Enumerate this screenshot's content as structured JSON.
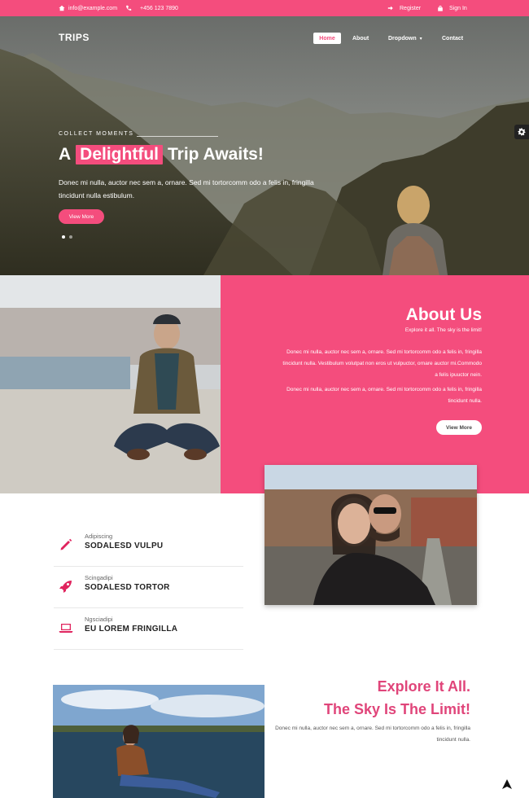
{
  "topbar": {
    "email": "info@example.com",
    "phone": "+456 123 7890",
    "register": "Register",
    "signin": "Sign In"
  },
  "header": {
    "brand": "TRIPS",
    "nav": [
      "Home",
      "About",
      "Dropdown",
      "Contact"
    ]
  },
  "hero": {
    "eyebrow": "COLLECT MOMENTS",
    "headline_pre": "A",
    "headline_highlight": "Delightful",
    "headline_post": "Trip Awaits!",
    "text": "Donec mi nulla, auctor nec sem a, ornare. Sed mi tortorcomm odo a felis in, fringilla tincidunt nulla estibulum.",
    "button": "View More",
    "slides": 2
  },
  "about": {
    "title": "About Us",
    "subtitle": "Explore it all. The sky is the limit!",
    "p1": "Donec mi nulla, auctor nec sem a, ornare. Sed mi tortorcomm odo a felis in, fringilla tincidunt nulla. Vestibulum volutpat non eros ut vulpuctor, ornare auctor mi.Commodo a felis ipuuctor nein.",
    "p2": "Donec mi nulla, auctor nec sem a, ornare. Sed mi tortorcomm odo a felis in, fringilla tincidunt nulla.",
    "button": "View More"
  },
  "features": [
    {
      "caption": "Adipiscing",
      "title": "SODALESD VULPU",
      "icon": "pencil-icon"
    },
    {
      "caption": "Scingadipi",
      "title": "SODALESD TORTOR",
      "icon": "rocket-icon"
    },
    {
      "caption": "Ngsciadipi",
      "title": "EU LOREM FRINGILLA",
      "icon": "laptop-icon"
    }
  ],
  "explore": {
    "title_line1": "Explore It All.",
    "title_line2": "The Sky Is The Limit!",
    "text": "Donec mi nulla, auctor nec sem a, ornare. Sed mi tortorcomm odo a felis in, fringilla tincidunt nulla."
  },
  "colors": {
    "accent": "#f44d7d",
    "accent_dark": "#e0245e"
  }
}
